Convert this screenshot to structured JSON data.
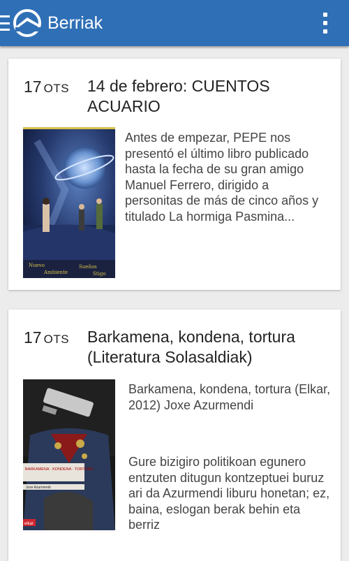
{
  "app": {
    "title": "Berriak"
  },
  "icons": {
    "menu": "menu-icon",
    "logo": "app-logo-icon",
    "overflow": "more-vert-icon"
  },
  "colors": {
    "appbar": "#2f6fb6",
    "background": "#ececec",
    "card": "#ffffff"
  },
  "posts": [
    {
      "day": "17",
      "month": "OTS",
      "title": "14 de febrero: CUENTOS ACUARIO",
      "excerpt": "Antes de empezar, PEPE nos presentó el último libro publicado hasta la fecha de su gran amigo Manuel Ferrero, dirigido a personitas de más de cinco años y titulado La hormiga Pasmina...",
      "image_desc": "book-cover-space-scene"
    },
    {
      "day": "17",
      "month": "OTS",
      "title": "Barkamena, kondena, tortura (Literatura Solasaldiak)",
      "book_info": "Barkamena, kondena, tortura (Elkar, 2012) Joxe Azurmendi",
      "excerpt": "Gure bizigiro politikoan egunero entzuten ditugun kontzeptuei buruz ari da Azurmendi liburu honetan; ez, baina, eslogan berak behin eta berriz",
      "image_desc": "book-cover-camera-uniform"
    }
  ]
}
